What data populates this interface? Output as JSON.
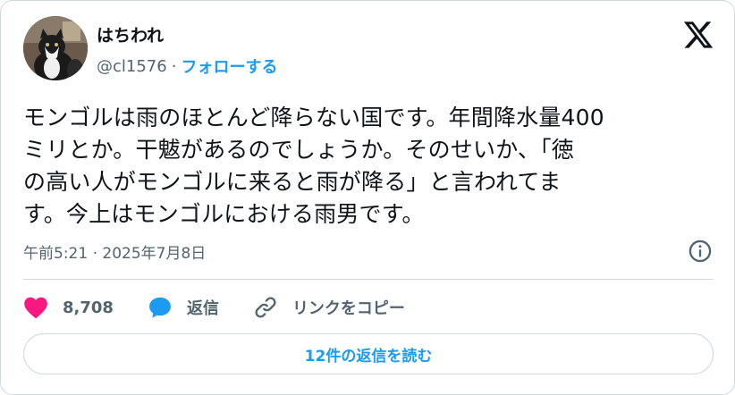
{
  "author": {
    "name": "はちわれ",
    "handle": "@cl1576",
    "separator": "·",
    "follow_label": "フォローする"
  },
  "tweet": {
    "lines": [
      "モンゴルは雨のほとんど降らない国です。年間降水量400",
      "ミリとか。干魃があるのでしょうか。そのせいか、「徳",
      "の高い人がモンゴルに来ると雨が降る」と言われてま",
      "す。今上はモンゴルにおける雨男です。"
    ],
    "timestamp": "午前5:21 · 2025年7月8日"
  },
  "actions": {
    "like_count": "8,708",
    "reply_label": "返信",
    "copy_link_label": "リンクをコピー"
  },
  "replies_button": {
    "label": "12件の返信を読む"
  },
  "colors": {
    "accent": "#1d9bf0",
    "like": "#f91880",
    "text": "#0f1419",
    "muted": "#536471",
    "border": "#cfd9de"
  },
  "icons": {
    "brand": "x-logo-icon",
    "info": "info-icon",
    "like": "heart-icon",
    "reply": "speech-bubble-icon",
    "link": "link-icon"
  }
}
